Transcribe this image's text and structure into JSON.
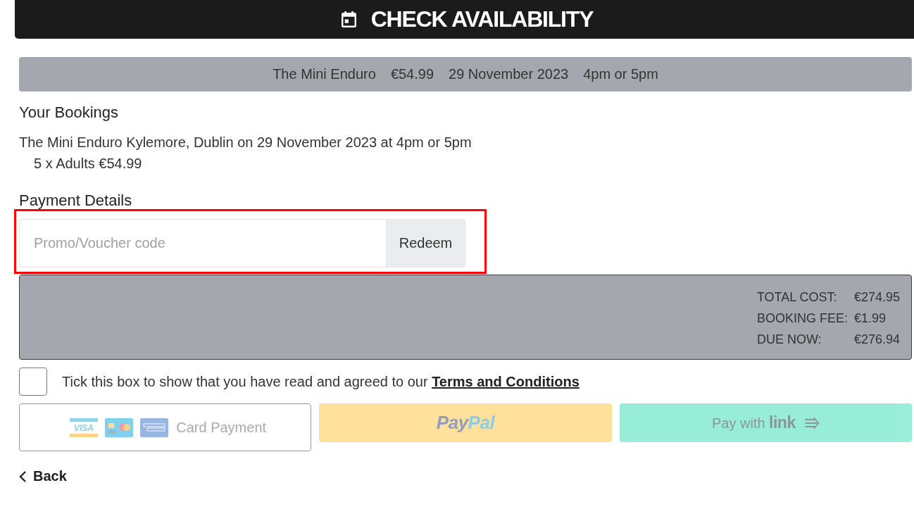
{
  "header": {
    "title": "CHECK AVAILABILITY"
  },
  "summary": [
    "The Mini Enduro",
    "€54.99",
    "29 November 2023",
    "4pm or 5pm"
  ],
  "bookings": {
    "heading": "Your Bookings",
    "items": [
      {
        "description": "The Mini Enduro Kylemore, Dublin on 29 November 2023 at 4pm or 5pm",
        "lines": [
          "5 x Adults €54.99"
        ]
      }
    ]
  },
  "payment": {
    "heading": "Payment Details",
    "promo": {
      "highlighted": true,
      "placeholder": "Promo/Voucher code",
      "button": "Redeem"
    }
  },
  "totals": [
    {
      "label": "TOTAL COST:",
      "value": "€274.95"
    },
    {
      "label": "BOOKING FEE:",
      "value": "€1.99"
    },
    {
      "label": "DUE NOW:",
      "value": "€276.94"
    }
  ],
  "terms": {
    "checked": false,
    "text": "Tick this box to show that you have read and agreed to our",
    "link": "Terms and Conditions"
  },
  "payment_options": [
    {
      "kind": "card",
      "disabled": true,
      "card_logo_text": "VISA",
      "label": "Card Payment"
    },
    {
      "kind": "paypal",
      "disabled": true,
      "label": [
        "Pay",
        "Pal"
      ]
    },
    {
      "kind": "link",
      "disabled": true,
      "label": "Pay with",
      "logo": "link"
    }
  ],
  "back": {
    "label": "Back"
  }
}
